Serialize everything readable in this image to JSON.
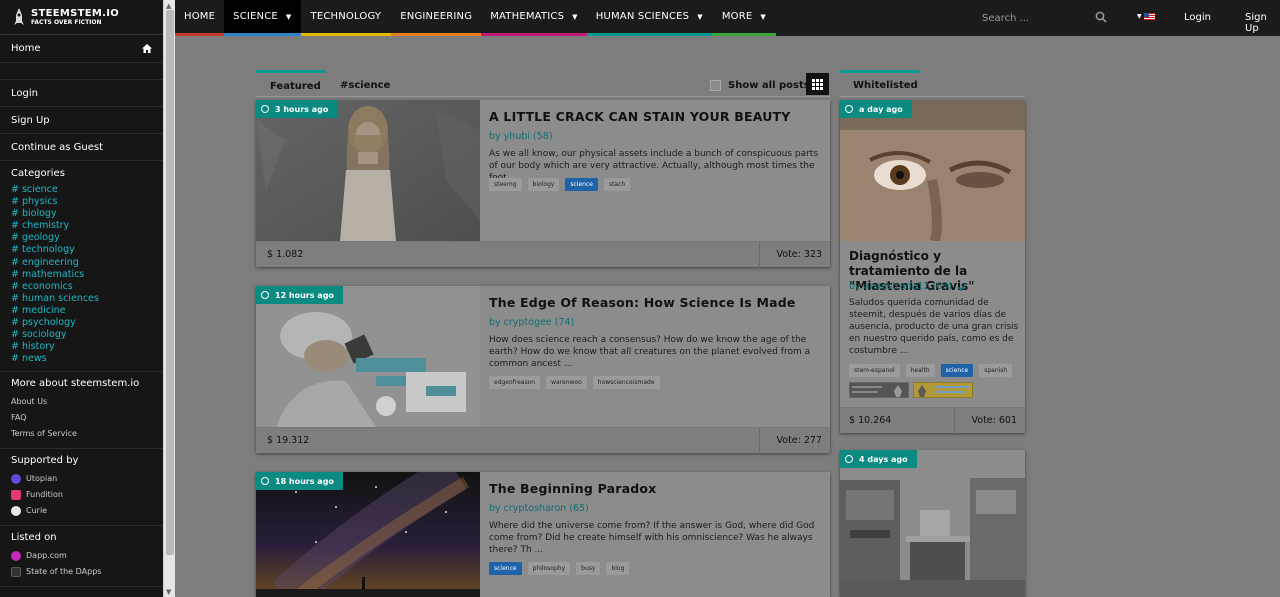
{
  "brand": {
    "name": "STEEMSTEM.IO",
    "tagline": "FACTS OVER FICTION"
  },
  "sidebar": {
    "home": "Home",
    "login": "Login",
    "signup": "Sign Up",
    "guest": "Continue as Guest",
    "categories_title": "Categories",
    "categories": [
      "# science",
      "# physics",
      "# biology",
      "# chemistry",
      "# geology",
      "# technology",
      "# engineering",
      "# mathematics",
      "# economics",
      "# human sciences",
      "# medicine",
      "# psychology",
      "# sociology",
      "# history",
      "# news"
    ],
    "more_title": "More about steemstem.io",
    "more_links": [
      "About Us",
      "FAQ",
      "Terms of Service"
    ],
    "supported_title": "Supported by",
    "supporters": [
      "Utopian",
      "Fundition",
      "Curie"
    ],
    "listed_title": "Listed on",
    "listed": [
      "Dapp.com",
      "State of the DApps"
    ]
  },
  "nav": {
    "items": [
      {
        "label": "HOME",
        "color": "#c0392b"
      },
      {
        "label": "SCIENCE",
        "color": "#2d82c8"
      },
      {
        "label": "TECHNOLOGY",
        "color": "#e5b700"
      },
      {
        "label": "ENGINEERING",
        "color": "#e67e22"
      },
      {
        "label": "MATHEMATICS",
        "color": "#c2187a"
      },
      {
        "label": "HUMAN SCIENCES",
        "color": "#0b9b93"
      },
      {
        "label": "MORE",
        "color": "#3aa539"
      }
    ],
    "search_placeholder": "Search ...",
    "login": "Login",
    "signup": "Sign Up"
  },
  "tabs": {
    "featured": "Featured",
    "science": "#science",
    "show_all": "Show all posts",
    "whitelisted": "Whitelisted"
  },
  "posts": [
    {
      "time": "3 hours ago",
      "title": "A LITTLE CRACK CAN STAIN YOUR BEAUTY",
      "author": "by yhubi (58)",
      "excerpt": "As we all know, our physical assets include a bunch of conspicuous parts of our body which are very attractive. Actually, although most times the foot ...",
      "tags": [
        "steemg",
        "biology",
        "science",
        "stach"
      ],
      "amount": "$ 1.082",
      "votes": "Vote: 323"
    },
    {
      "time": "12 hours ago",
      "title": "The Edge Of Reason: How Science Is Made",
      "author": "by cryptogee (74)",
      "excerpt": "How does science reach a consensus? How do we know the age of the earth? How do we know that all creatures on the planet evolved from a common ancest ...",
      "tags": [
        "edgeofreason",
        "warenwoo",
        "howscienceismade"
      ],
      "amount": "$ 19.312",
      "votes": "Vote: 277"
    },
    {
      "time": "18 hours ago",
      "title": "The Beginning Paradox",
      "author": "by cryptosharon (65)",
      "excerpt": "Where did the universe come from? If the answer is God, where did God come from? Did he create himself with his omniscience? Was he always there? Th ...",
      "tags": [
        "science",
        "philosophy",
        "busy",
        "blog"
      ]
    }
  ],
  "whitelisted": [
    {
      "time": "a day ago",
      "title": "Diagnóstico y tratamiento de la \"Miastenia Gravis\"",
      "author": "by anaestrada12 (63)",
      "excerpt": "Saludos querida comunidad de steemit, después de varios días de ausencia, producto de una gran crisis en nuestro querido país, como es de costumbre ...",
      "tags": [
        "stem-espanol",
        "health",
        "science",
        "spanish"
      ],
      "amount": "$ 10.264",
      "votes": "Vote: 601"
    },
    {
      "time": "4 days ago"
    }
  ]
}
